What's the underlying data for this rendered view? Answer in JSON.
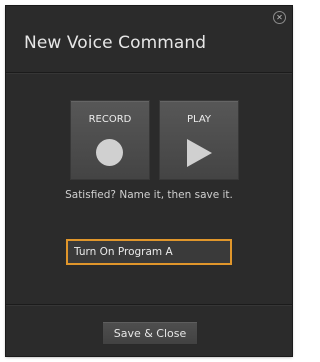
{
  "dialog": {
    "title": "New Voice Command",
    "close_icon": "close-icon",
    "close_glyph": "✕"
  },
  "record": {
    "label": "RECORD",
    "icon": "record-icon"
  },
  "play": {
    "label": "PLAY",
    "icon": "play-icon"
  },
  "hint": "Satisfied? Name it, then save it.",
  "name_field": {
    "value": "Turn On Program A"
  },
  "footer": {
    "save_label": "Save & Close"
  },
  "colors": {
    "background": "#2b2b2b",
    "tile": "#4b4b4b",
    "accent": "#e0962b",
    "icon": "#d0d0d0"
  }
}
